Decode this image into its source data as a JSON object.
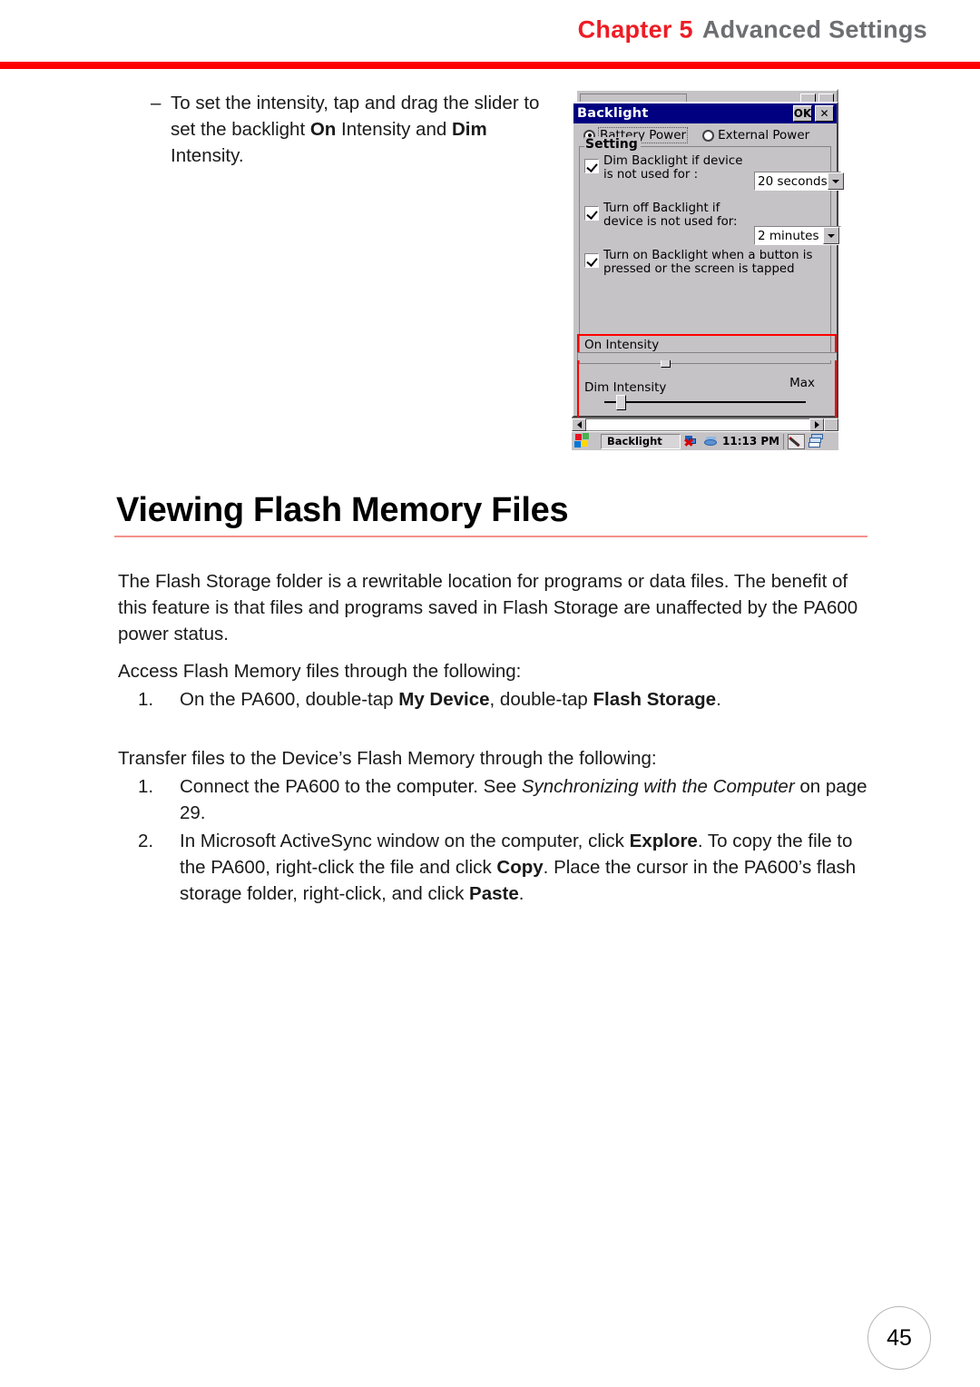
{
  "header": {
    "chapter_label": "Chapter 5",
    "chapter_title": "Advanced Settings",
    "rule_color": "#fe0000",
    "chapter_label_color": "#ed1c24",
    "chapter_title_color": "#6d6e71"
  },
  "intro_bullet": {
    "dash": "–",
    "text_1": "To set the intensity, tap and drag the slider to set the backlight ",
    "bold_1": "On",
    "text_2": " Intensity and ",
    "bold_2": "Dim",
    "text_3": " Intensity."
  },
  "device_screenshot": {
    "dialog_title": "Backlight",
    "ok_button": "OK",
    "close_button": "✕",
    "power_options": [
      {
        "label": "Battery Power",
        "selected": true
      },
      {
        "label": "External Power",
        "selected": false
      }
    ],
    "group_legend": "Setting",
    "checkboxes": [
      {
        "line1": "Dim Backlight if device",
        "line2": "is not used for :",
        "checked": true,
        "combo_value": "20 seconds"
      },
      {
        "line1": "Turn off Backlight if",
        "line2": "device is not used for:",
        "checked": true,
        "combo_value": "2 minutes"
      },
      {
        "line1": "Turn on Backlight when a button is",
        "line2": "pressed or the screen is tapped",
        "checked": true,
        "combo_value": null
      }
    ],
    "sliders": [
      {
        "label": "On Intensity",
        "position_percent": 30
      },
      {
        "label": "Dim Intensity",
        "position_percent": 8
      }
    ],
    "max_label": "Max",
    "highlight_color": "#ff0000",
    "taskbar": {
      "task_label": "Backlight",
      "clock": "11:13 PM"
    }
  },
  "section": {
    "heading": "Viewing Flash Memory Files",
    "rule_color": "#f4918c"
  },
  "body": {
    "paragraph_1": "The Flash Storage folder is a rewritable location for programs or data files. The benefit of this feature is that files and programs saved in Flash Storage are unaffected by the PA600 power status.",
    "paragraph_2": "Access Flash Memory files through the following:",
    "list_1": [
      {
        "num": "1.",
        "text_1": "On the PA600, double-tap ",
        "bold_1": "My Device",
        "text_2": ", double-tap ",
        "bold_2": "Flash Storage",
        "text_3": "."
      }
    ],
    "paragraph_3": "Transfer files to the Device’s Flash Memory through the following:",
    "list_2": [
      {
        "num": "1.",
        "text_1": "Connect the PA600 to the computer. See ",
        "italic_1": "Synchronizing with the Computer",
        "text_2": " on page 29."
      },
      {
        "num": "2.",
        "text_1": "In Microsoft ActiveSync window on the computer, click ",
        "bold_1": "Explore",
        "text_2": ". To copy the file to the PA600, right-click the file and click ",
        "bold_2": "Copy",
        "text_3": ". Place the cursor in the PA600’s flash storage folder, right-click, and click ",
        "bold_3": "Paste",
        "text_4": "."
      }
    ]
  },
  "footer": {
    "page_number": "45"
  }
}
